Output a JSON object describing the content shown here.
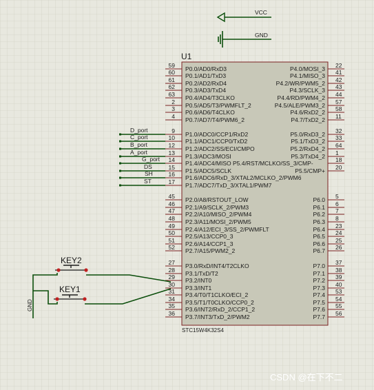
{
  "supply": {
    "vcc_label": "VCC",
    "gnd_label": "GND"
  },
  "chip": {
    "ref": "U1",
    "part": "STC15W4K32S4",
    "left_pins": [
      {
        "num": "59",
        "name": "P0.0/AD0/RxD3"
      },
      {
        "num": "60",
        "name": "P0.1/AD1/TxD3"
      },
      {
        "num": "61",
        "name": "P0.2/AD2/RxD4"
      },
      {
        "num": "62",
        "name": "P0.3/AD3/TxD4"
      },
      {
        "num": "63",
        "name": "P0.4/AD4/T3CLKO"
      },
      {
        "num": "2",
        "name": "P0.5/AD5/T3/PWMFLT_2"
      },
      {
        "num": "3",
        "name": "P0.6/AD6/T4CLKO"
      },
      {
        "num": "4",
        "name": "P0.7/AD7/T4/PWM6_2"
      },
      {
        "num": "9",
        "name": "P1.0/ADC0/CCP1/RxD2"
      },
      {
        "num": "10",
        "name": "P1.1/ADC1/CCP0/TxD2"
      },
      {
        "num": "12",
        "name": "P1.2/ADC2/SS/ECI/CMPO"
      },
      {
        "num": "13",
        "name": "P1.3/ADC3/MOSI"
      },
      {
        "num": "14",
        "name": "P1.4/ADC4/MISO   P5.4/RST/MCLKO/SS_3/CMP-"
      },
      {
        "num": "15",
        "name": "P1.5/ADC5/SCLK"
      },
      {
        "num": "16",
        "name": "P1.6/ADC6/RxD_3/XTAL2/MCLKO_2/PWM6"
      },
      {
        "num": "17",
        "name": "P1.7/ADC7/TxD_3/XTAL1/PWM7"
      },
      {
        "num": "45",
        "name": "P2.0/A8/RSTOUT_LOW"
      },
      {
        "num": "46",
        "name": "P2.1/A9/SCLK_2/PWM3"
      },
      {
        "num": "47",
        "name": "P2.2/A10/MISO_2/PWM4"
      },
      {
        "num": "48",
        "name": "P2.3/A11/MOSI_2/PWM5"
      },
      {
        "num": "49",
        "name": "P2.4/A12/ECI_3/SS_2/PWMFLT"
      },
      {
        "num": "50",
        "name": "P2.5/A13/CCP0_3"
      },
      {
        "num": "51",
        "name": "P2.6/A14/CCP1_3"
      },
      {
        "num": "52",
        "name": "P2.7/A15/PWM2_2"
      },
      {
        "num": "27",
        "name": "P3.0/RxD/INT4/T2CLKO"
      },
      {
        "num": "28",
        "name": "P3.1/TxD/T2"
      },
      {
        "num": "29",
        "name": "P3.2/INT0"
      },
      {
        "num": "30",
        "name": "P3.3/INT1"
      },
      {
        "num": "31",
        "name": "P3.4/T0/T1CLKO/ECI_2"
      },
      {
        "num": "34",
        "name": "P3.5/T1/T0CLKO/CCP0_2"
      },
      {
        "num": "35",
        "name": "P3.6/INT2/RxD_2/CCP1_2"
      },
      {
        "num": "36",
        "name": "P3.7/INT3/TxD_2/PWM2"
      }
    ],
    "right_pins": [
      {
        "num": "22",
        "name": "P4.0/MOSI_3"
      },
      {
        "num": "41",
        "name": "P4.1/MISO_3"
      },
      {
        "num": "42",
        "name": "P4.2/WR/PWM5_2"
      },
      {
        "num": "43",
        "name": "P4.3/SCLK_3"
      },
      {
        "num": "44",
        "name": "P4.4/RD/PWM4_2"
      },
      {
        "num": "57",
        "name": "P4.5/ALE/PWM3_2"
      },
      {
        "num": "58",
        "name": "P4.6/RxD2_2"
      },
      {
        "num": "11",
        "name": "P4.7/TxD2_2"
      },
      {
        "num": "32",
        "name": "P5.0/RxD3_2"
      },
      {
        "num": "33",
        "name": "P5.1/TxD3_2"
      },
      {
        "num": "64",
        "name": "P5.2/RxD4_2"
      },
      {
        "num": "1",
        "name": "P5.3/TxD4_2"
      },
      {
        "num": "18",
        "name": ""
      },
      {
        "num": "20",
        "name": "P5.5/CMP+"
      },
      {
        "num": "5",
        "name": "P6.0"
      },
      {
        "num": "6",
        "name": "P6.1"
      },
      {
        "num": "7",
        "name": "P6.2"
      },
      {
        "num": "8",
        "name": "P6.3"
      },
      {
        "num": "23",
        "name": "P6.4"
      },
      {
        "num": "24",
        "name": "P6.5"
      },
      {
        "num": "25",
        "name": "P6.6"
      },
      {
        "num": "26",
        "name": "P6.7"
      },
      {
        "num": "37",
        "name": "P7.0"
      },
      {
        "num": "38",
        "name": "P7.1"
      },
      {
        "num": "39",
        "name": "P7.2"
      },
      {
        "num": "40",
        "name": "P7.3"
      },
      {
        "num": "53",
        "name": "P7.4"
      },
      {
        "num": "54",
        "name": "P7.5"
      },
      {
        "num": "55",
        "name": "P7.6"
      },
      {
        "num": "56",
        "name": "P7.7"
      }
    ]
  },
  "net_labels": [
    "D_port",
    "C_port",
    "B_port",
    "A_port",
    "G_port",
    "DS",
    "SH",
    "ST"
  ],
  "keys": {
    "key1": "KEY1",
    "key2": "KEY2",
    "gnd": "GND"
  },
  "watermark": "CSDN @在下不二"
}
